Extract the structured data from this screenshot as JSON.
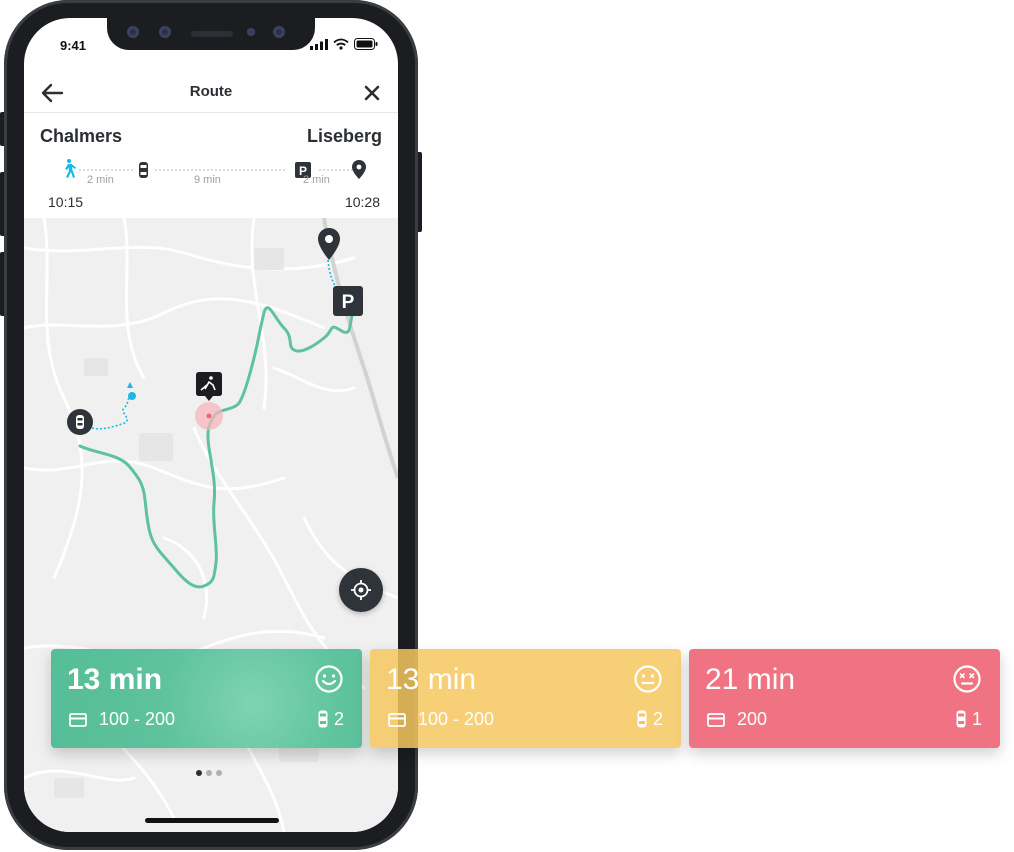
{
  "status": {
    "time": "9:41"
  },
  "header": {
    "title": "Route"
  },
  "route": {
    "origin": "Chalmers",
    "destination": "Liseberg",
    "start_time": "10:15",
    "end_time": "10:28",
    "segments": [
      {
        "label": "2 min",
        "icon": "walk-icon"
      },
      {
        "label": "9 min",
        "icon": "car-icon"
      },
      {
        "label": "2 min",
        "icon": "parking-icon"
      }
    ],
    "end_icon": "location-pin-icon"
  },
  "map": {
    "route_color": "#5dc29d",
    "walk_color": "#1ab8e6"
  },
  "pagination": {
    "pages": 3,
    "active": 1
  },
  "options": [
    {
      "duration": "13 min",
      "price": "100 - 200",
      "cars": "2",
      "mood": "happy",
      "color": "#5dc29d"
    },
    {
      "duration": "13 min",
      "price": "100 - 200",
      "cars": "2",
      "mood": "neutral",
      "color": "#f5c75e"
    },
    {
      "duration": "21 min",
      "price": "200",
      "cars": "1",
      "mood": "dizzy",
      "color": "#ef7382"
    }
  ]
}
